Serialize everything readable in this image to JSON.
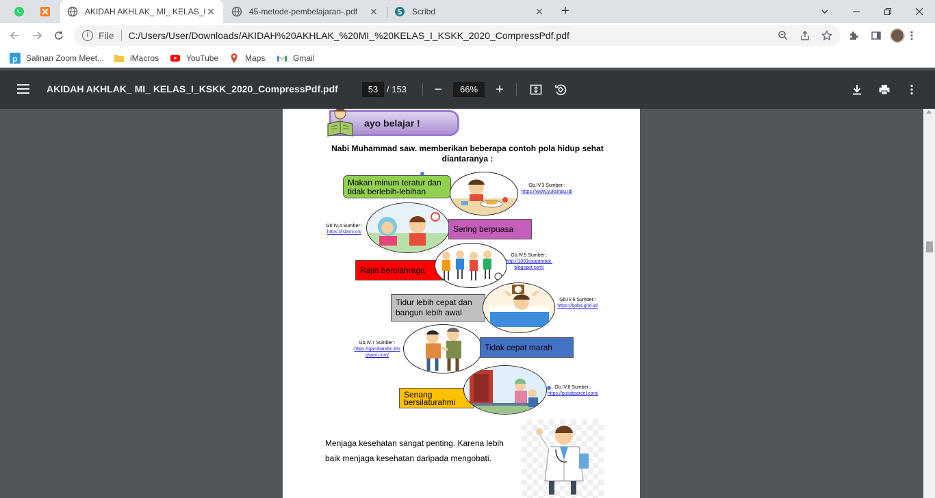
{
  "browser": {
    "tabs": [
      {
        "title": "AKIDAH AKHLAK_ MI_ KELAS_I_KSKK_2020_CompressPdf.pdf",
        "active": true
      },
      {
        "title": "45-metode-pembelajaran-.pdf",
        "active": false
      },
      {
        "title": "Scribd",
        "active": false
      }
    ],
    "new_tab_label": "+",
    "omnibox": {
      "scheme": "File",
      "url": "C:/Users/User/Downloads/AKIDAH%20AKHLAK_%20MI_%20KELAS_I_KSKK_2020_CompressPdf.pdf"
    },
    "bookmarks": [
      {
        "label": "Salinan Zoom Meet...",
        "icon": "p-icon"
      },
      {
        "label": "iMacros",
        "icon": "folder-icon"
      },
      {
        "label": "YouTube",
        "icon": "youtube-icon"
      },
      {
        "label": "Maps",
        "icon": "maps-icon"
      },
      {
        "label": "Gmail",
        "icon": "gmail-icon"
      }
    ]
  },
  "pdf": {
    "title": "AKIDAH AKHLAK_ MI_ KELAS_I_KSKK_2020_CompressPdf.pdf",
    "page_current": "53",
    "page_total": "/ 153",
    "zoom": "66%"
  },
  "page": {
    "banner": "ayo belajar !",
    "heading_line1": "Nabi Muhammad saw. memberikan beberapa  contoh pola hidup sehat",
    "heading_line2": "diantaranya :",
    "items": [
      {
        "label_line1": "Makan minum teratur dan",
        "label_line2": "tidak berlebih-lebihan",
        "caption": "Gb.IV.3 Sumber :",
        "link": "https://www.yuksinau.id/",
        "color": "#92d050"
      },
      {
        "label_line1": "Sering berpuasa",
        "label_line2": "",
        "caption": "Gb.IV.4 Sumber :",
        "link": "https://islami.co/",
        "color": "#c55dba"
      },
      {
        "label_line1": "Rajin berolahraga",
        "label_line2": "",
        "caption": "Gb.IV.5 Sumber :",
        "link_line1": "http://1001topgambar.",
        "link_line2": "blogspot.com/",
        "color": "#ff0000"
      },
      {
        "label_line1": "Tidur lebih cepat dan",
        "label_line2": "bangun lebih awal",
        "caption": "Gb.IV.6 Sumber :",
        "link": "https://bobo.grid.id/",
        "color": "#c0c0c0"
      },
      {
        "label_line1": "Tidak cepat marah",
        "label_line2": "",
        "caption": "Gb.IV.7 Sumber :",
        "link_line1": "https://gambarabc.blo",
        "link_line2": "gspot.com/",
        "color": "#4472c4"
      },
      {
        "label_line1": "Senang",
        "label_line2": "bersilaturahmi",
        "caption": "Gb.IV.8 Sumber :",
        "link": "https://pusatparcel.com/",
        "color": "#ffc000"
      }
    ],
    "body_line1": "Menjaga kesehatan sangat penting. Karena lebih",
    "body_line2": "baik menjaga kesehatan daripada mengobati."
  }
}
